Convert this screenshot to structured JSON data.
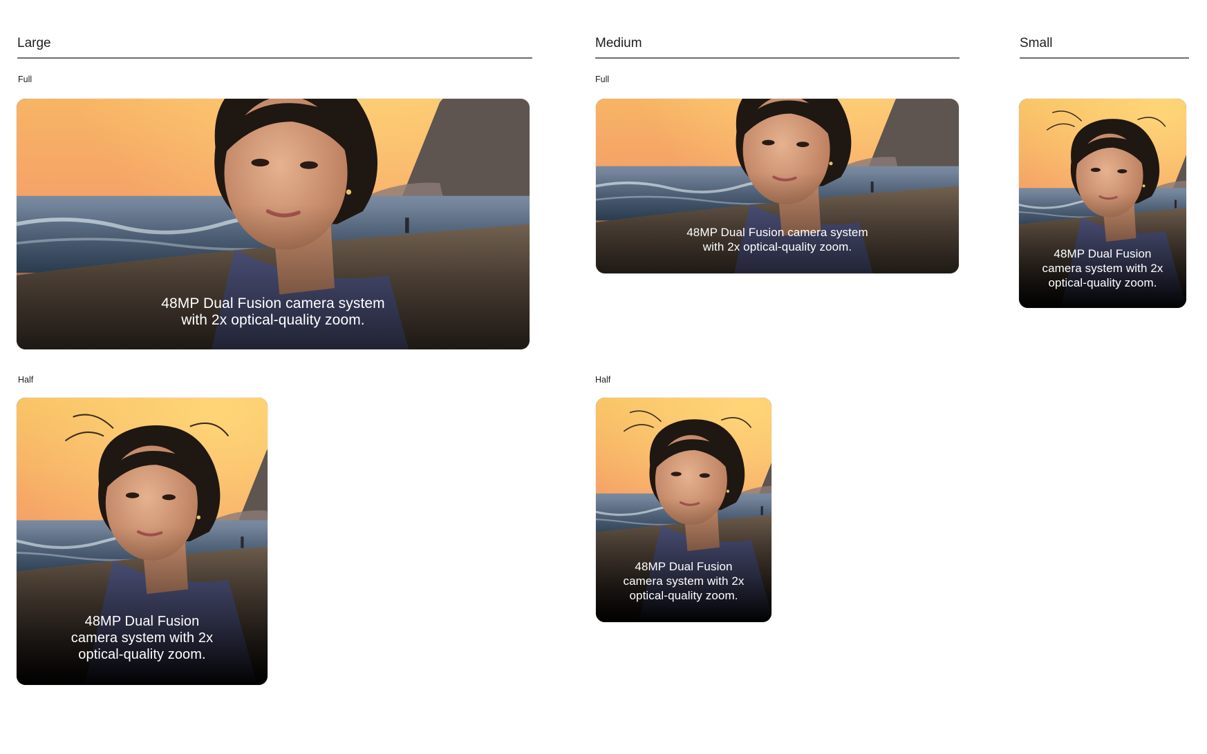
{
  "columns": {
    "large": "Large",
    "medium": "Medium",
    "small": "Small"
  },
  "variants": {
    "full": "Full",
    "half": "Half"
  },
  "tiles": {
    "large_full": {
      "line1": "48MP Dual Fusion camera system",
      "line2": "with 2x optical-quality zoom."
    },
    "large_half": {
      "line1": "48MP Dual Fusion",
      "line2": "camera system with 2x",
      "line3": "optical-quality zoom."
    },
    "medium_full": {
      "line1": "48MP Dual Fusion camera system",
      "line2": "with 2x optical-quality zoom."
    },
    "medium_half": {
      "line1": "48MP Dual Fusion",
      "line2": "camera system with 2x",
      "line3": "optical-quality zoom."
    },
    "small_full": {
      "line1": "48MP Dual Fusion",
      "line2": "camera system with 2x",
      "line3": "optical-quality zoom."
    }
  },
  "colors": {
    "sky_top": "#f7b45a",
    "sky_mid": "#f39a63",
    "sea": "#4d6c84",
    "sand": "#5d4d40",
    "hair": "#1f1712",
    "skin": "#d9a27f",
    "scarf": "#5a5f8e",
    "caption_text": "#ffffff"
  },
  "icons": {
    "photo": "portrait-photo-icon"
  }
}
